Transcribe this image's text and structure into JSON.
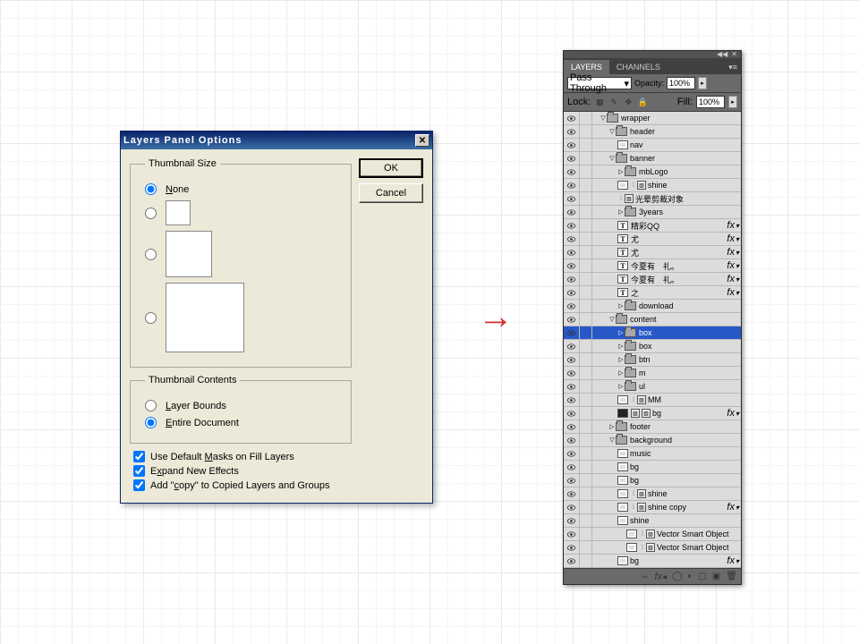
{
  "dialog": {
    "title": "Layers Panel Options",
    "thumb_size_label": "Thumbnail Size",
    "none_label": "None",
    "thumb_contents_label": "Thumbnail Contents",
    "layer_bounds": "Layer Bounds",
    "entire_doc": "Entire Document",
    "chk1": "Use Default Masks on Fill Layers",
    "chk2": "Expand New Effects",
    "chk3": "Add \"copy\" to Copied Layers and Groups",
    "ok": "OK",
    "cancel": "Cancel"
  },
  "panel": {
    "tab1": "LAYERS",
    "tab2": "CHANNELS",
    "blend": "Pass Through",
    "opacity_label": "Opacity:",
    "opacity": "100%",
    "lock_label": "Lock:",
    "fill_label": "Fill:",
    "fill": "100%"
  },
  "layers": [
    {
      "d": 0,
      "t": "folder",
      "open": "▽",
      "n": "wrapper"
    },
    {
      "d": 1,
      "t": "folder",
      "open": "▽",
      "n": "header"
    },
    {
      "d": 2,
      "t": "layer",
      "mask": true,
      "n": "nav"
    },
    {
      "d": 1,
      "t": "folder",
      "open": "▽",
      "n": "banner"
    },
    {
      "d": 2,
      "t": "folder",
      "open": "▷",
      "n": "mbLogo"
    },
    {
      "d": 2,
      "t": "layer",
      "mask": true,
      "sm": true,
      "n": "shine"
    },
    {
      "d": 2,
      "t": "layer",
      "sm": true,
      "n": "光晕剪裁对象"
    },
    {
      "d": 2,
      "t": "folder",
      "open": "▷",
      "n": "3years"
    },
    {
      "d": 2,
      "t": "text",
      "n": "精彩QQ",
      "fx": true
    },
    {
      "d": 2,
      "t": "text",
      "n": "尤",
      "fx": true
    },
    {
      "d": 2,
      "t": "text",
      "n": "尤",
      "fx": true
    },
    {
      "d": 2,
      "t": "text",
      "n": "今夏有　礼。",
      "fx": true
    },
    {
      "d": 2,
      "t": "text",
      "n": "今夏有　礼。",
      "fx": true
    },
    {
      "d": 2,
      "t": "text",
      "n": "之",
      "fx": true
    },
    {
      "d": 2,
      "t": "folder",
      "open": "▷",
      "n": "download"
    },
    {
      "d": 1,
      "t": "folder",
      "open": "▽",
      "n": "content"
    },
    {
      "d": 2,
      "t": "folder",
      "open": "▷",
      "n": "box",
      "sel": true
    },
    {
      "d": 2,
      "t": "folder",
      "open": "▷",
      "n": "box"
    },
    {
      "d": 2,
      "t": "folder",
      "open": "▷",
      "n": "btn"
    },
    {
      "d": 2,
      "t": "folder",
      "open": "▷",
      "n": "m"
    },
    {
      "d": 2,
      "t": "folder",
      "open": "▷",
      "n": "ul"
    },
    {
      "d": 2,
      "t": "layer",
      "mask": true,
      "sm": true,
      "n": "MM"
    },
    {
      "d": 2,
      "t": "layer",
      "dark": true,
      "sm2": true,
      "n": "bg",
      "fx": true
    },
    {
      "d": 1,
      "t": "folder",
      "open": "▷",
      "n": "footer"
    },
    {
      "d": 1,
      "t": "folder",
      "open": "▽",
      "n": "background"
    },
    {
      "d": 2,
      "t": "layer",
      "mask": true,
      "n": "music"
    },
    {
      "d": 2,
      "t": "layer",
      "mask": true,
      "n": "bg"
    },
    {
      "d": 2,
      "t": "layer",
      "mask": true,
      "n": "bg"
    },
    {
      "d": 2,
      "t": "layer",
      "mask": true,
      "sm": true,
      "n": "shine"
    },
    {
      "d": 2,
      "t": "layer",
      "mask": true,
      "sm": true,
      "n": "shine copy",
      "fx": true
    },
    {
      "d": 2,
      "t": "layer",
      "mask": true,
      "n": "shine"
    },
    {
      "d": 3,
      "t": "layer",
      "mask": true,
      "sm": true,
      "n": "Vector Smart Object"
    },
    {
      "d": 3,
      "t": "layer",
      "mask": true,
      "sm": true,
      "n": "Vector Smart Object"
    },
    {
      "d": 2,
      "t": "layer",
      "mask": true,
      "n": "bg",
      "fx": true
    }
  ]
}
